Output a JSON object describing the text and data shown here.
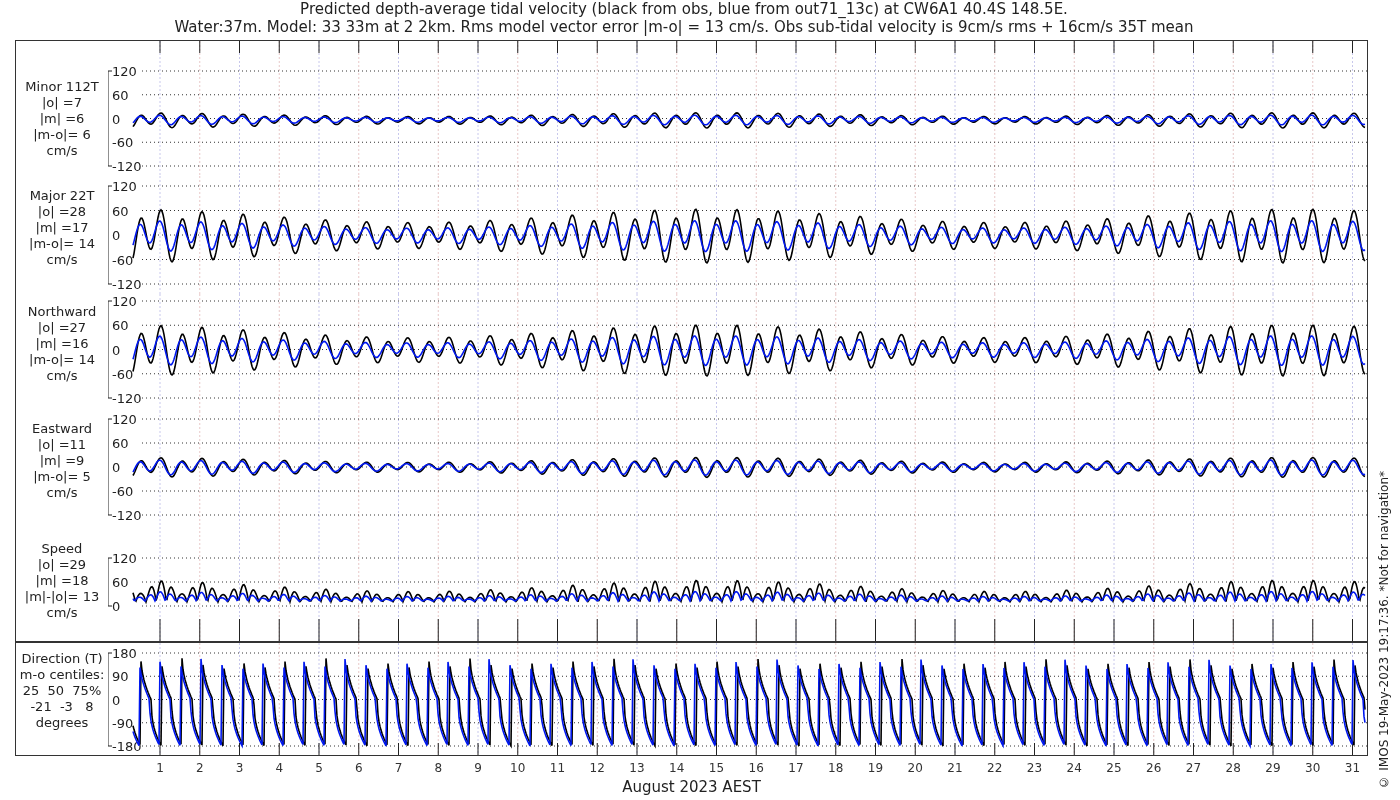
{
  "title_lines": [
    "Predicted depth-average tidal velocity (black from obs, blue from out71_13c) at CW6A1 40.4S 148.5E.",
    "Water:37m. Model: 33 33m at 2 2km. Rms model vector error |m-o| = 13 cm/s. Obs sub-tidal velocity is 9cm/s rms + 16cm/s 35T mean"
  ],
  "panels": [
    {
      "kind": "signed",
      "label_lines": [
        "Minor 112T",
        "|o| =7",
        "|m| =6",
        "|m-o|= 6",
        "cm/s"
      ],
      "yticks": [
        "120",
        "60",
        "0",
        "-60",
        "-120"
      ]
    },
    {
      "kind": "signed",
      "label_lines": [
        "Major 22T",
        "|o| =28",
        "|m| =17",
        "|m-o|= 14",
        "cm/s"
      ],
      "yticks": [
        "120",
        "60",
        "0",
        "-60",
        "-120"
      ]
    },
    {
      "kind": "signed",
      "label_lines": [
        "Northward",
        "|o| =27",
        "|m| =16",
        "|m-o|= 14",
        "cm/s"
      ],
      "yticks": [
        "120",
        "60",
        "0",
        "-60",
        "-120"
      ]
    },
    {
      "kind": "signed",
      "label_lines": [
        "Eastward",
        "|o| =11",
        "|m| =9",
        "|m-o|= 5",
        "cm/s"
      ],
      "yticks": [
        "120",
        "60",
        "0",
        "-60",
        "-120"
      ]
    },
    {
      "kind": "speed",
      "label_lines": [
        "Speed",
        "|o| =29",
        "|m| =18",
        "|m|-|o|= 13",
        "cm/s"
      ],
      "yticks": [
        "120",
        "60",
        "0"
      ]
    },
    {
      "kind": "direction",
      "label_lines": [
        "Direction (T)",
        "m-o centiles:",
        "25  50  75%",
        "-21  -3   8",
        "degrees"
      ],
      "yticks": [
        "180",
        "90",
        "0",
        "-90",
        "-180"
      ]
    }
  ],
  "days": [
    "1",
    "2",
    "3",
    "4",
    "5",
    "6",
    "7",
    "8",
    "9",
    "10",
    "11",
    "12",
    "13",
    "14",
    "15",
    "16",
    "17",
    "18",
    "19",
    "20",
    "21",
    "22",
    "23",
    "24",
    "25",
    "26",
    "27",
    "28",
    "29",
    "30",
    "31"
  ],
  "xlabel": "August 2023 AEST",
  "copyright": "© IMOS 19-May-2023 19:17:36.  *Not for navigation*"
}
